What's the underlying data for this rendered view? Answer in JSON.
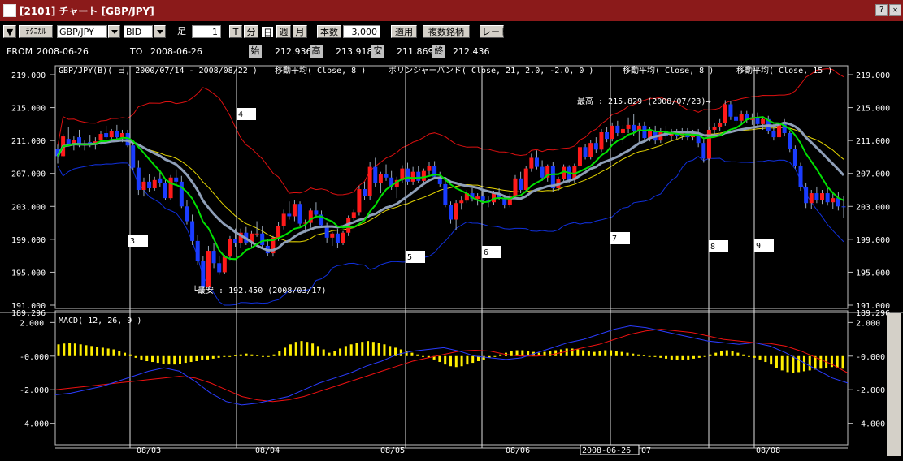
{
  "window": {
    "title": "[2101] チャート [GBP/JPY]"
  },
  "toolbar": {
    "menu_label": "▼",
    "technical_label": "ﾃｸﾆｶﾙ",
    "pair_value": "GBP/JPY",
    "side_value": "BID",
    "foot_label": "足",
    "foot_value": "1",
    "t_label": "T",
    "minute_label": "分",
    "day_label": "日",
    "week_label": "週",
    "month_label": "月",
    "count_label": "本数",
    "count_value": "3,000",
    "apply_label": "適用",
    "compare_label": "複数銘柄",
    "rate_label": "レート"
  },
  "infobar": {
    "from_label": "FROM",
    "from_value": "2008-06-26",
    "to_label": "TO",
    "to_value": "2008-06-26",
    "open_label": "始",
    "open_value": "212.936",
    "high_label": "高",
    "high_value": "213.918",
    "low_label": "安",
    "low_value": "211.869",
    "close_label": "終",
    "close_value": "212.436"
  },
  "chart_data": {
    "type": "candlestick",
    "title": "GBP/JPY(B)( 日, 2000/07/14 - 2008/08/22 )",
    "indicators": [
      "移動平均( Close, 8 )",
      "ボリンジャーバンド( Close, 21, 2.0, -2.0, 0 )",
      "移動平均( Close, 8 )",
      "移動平均( Close, 15 )"
    ],
    "price_axis_ticks": [
      "219.000",
      "215.000",
      "211.000",
      "207.000",
      "203.000",
      "199.000",
      "195.000",
      "191.000"
    ],
    "price_axis_marker": "189.296",
    "ylim": [
      191,
      219
    ],
    "high_annotation": "最高 : 215.829 (2008/07/23)",
    "low_annotation": "最安 : 192.450 (2008/03/17)",
    "wave_labels": [
      "3",
      "4",
      "5",
      "6",
      "7",
      "8",
      "9"
    ],
    "x_ticks": [
      "08/03",
      "08/04",
      "08/05",
      "08/06",
      "07",
      "08/08"
    ],
    "cursor_date": "2008-06-26",
    "macd": {
      "title": "MACD( 12, 26, 9 )",
      "ticks": [
        "2.000",
        "-0.000",
        "-2.000",
        "-4.000"
      ],
      "ylim": [
        -4.5,
        2.5
      ]
    },
    "colors": {
      "up": "#ff1a1a",
      "down": "#1a3cff",
      "ma8": "#00e000",
      "ma15": "#8f9fb8",
      "boll_upper": "#dd1010",
      "boll_lower": "#1030dd",
      "boll_mid": "#e6d600",
      "macd_hist": "#ffee00",
      "macd_line": "#2a3cff",
      "signal_line": "#ee1111"
    },
    "candles": [
      [
        210.0,
        210.5,
        208.2,
        209.1
      ],
      [
        209.1,
        211.8,
        209.0,
        211.5
      ],
      [
        211.2,
        212.6,
        210.4,
        210.6
      ],
      [
        210.6,
        211.5,
        209.8,
        211.1
      ],
      [
        211.4,
        212.3,
        210.2,
        210.4
      ],
      [
        210.4,
        211.0,
        209.8,
        210.5
      ],
      [
        210.8,
        211.7,
        210.2,
        210.6
      ],
      [
        210.6,
        211.4,
        209.9,
        210.9
      ],
      [
        211.0,
        212.2,
        210.5,
        211.8
      ],
      [
        211.9,
        212.8,
        211.2,
        211.4
      ],
      [
        211.4,
        212.4,
        210.9,
        212.1
      ],
      [
        212.2,
        212.9,
        211.1,
        211.4
      ],
      [
        211.4,
        212.3,
        210.8,
        211.9
      ],
      [
        211.9,
        212.3,
        210.2,
        210.4
      ],
      [
        210.4,
        211.0,
        207.4,
        207.7
      ],
      [
        207.7,
        208.6,
        204.4,
        205.0
      ],
      [
        205.0,
        206.5,
        204.2,
        206.0
      ],
      [
        206.0,
        206.9,
        204.8,
        205.2
      ],
      [
        205.2,
        206.6,
        204.9,
        206.2
      ],
      [
        206.4,
        207.3,
        205.4,
        205.8
      ],
      [
        205.8,
        206.4,
        203.8,
        204.0
      ],
      [
        204.0,
        206.8,
        203.8,
        206.5
      ],
      [
        206.5,
        207.5,
        205.6,
        206.0
      ],
      [
        206.0,
        206.7,
        202.8,
        203.0
      ],
      [
        203.0,
        203.8,
        200.8,
        201.2
      ],
      [
        201.2,
        202.0,
        198.3,
        198.8
      ],
      [
        198.8,
        199.5,
        195.9,
        196.4
      ],
      [
        196.4,
        197.0,
        192.5,
        193.2
      ],
      [
        193.2,
        198.2,
        192.9,
        197.6
      ],
      [
        197.6,
        198.5,
        195.5,
        196.1
      ],
      [
        196.1,
        197.0,
        194.7,
        195.0
      ],
      [
        195.0,
        197.1,
        194.8,
        196.9
      ],
      [
        196.9,
        199.4,
        196.5,
        199.0
      ],
      [
        199.0,
        200.3,
        198.1,
        198.5
      ],
      [
        198.5,
        200.3,
        198.0,
        199.8
      ],
      [
        199.8,
        200.5,
        198.3,
        198.6
      ],
      [
        198.6,
        200.0,
        198.0,
        199.7
      ],
      [
        199.7,
        201.2,
        199.3,
        199.7
      ],
      [
        199.7,
        200.6,
        197.9,
        198.3
      ],
      [
        198.2,
        199.0,
        197.0,
        197.3
      ],
      [
        197.3,
        199.4,
        196.9,
        199.2
      ],
      [
        199.2,
        201.1,
        198.8,
        200.6
      ],
      [
        200.6,
        202.6,
        200.2,
        202.1
      ],
      [
        202.1,
        203.6,
        201.4,
        201.8
      ],
      [
        201.8,
        203.8,
        201.2,
        203.3
      ],
      [
        203.3,
        203.6,
        200.6,
        200.9
      ],
      [
        200.9,
        201.4,
        199.8,
        201.0
      ],
      [
        201.0,
        202.8,
        200.4,
        202.5
      ],
      [
        202.5,
        203.5,
        201.6,
        202.0
      ],
      [
        202.0,
        202.5,
        200.5,
        200.7
      ],
      [
        200.7,
        201.0,
        198.6,
        199.2
      ],
      [
        199.2,
        199.9,
        198.2,
        199.7
      ],
      [
        199.7,
        200.3,
        198.0,
        198.5
      ],
      [
        198.5,
        200.0,
        198.3,
        199.8
      ],
      [
        199.8,
        201.9,
        199.4,
        201.6
      ],
      [
        201.6,
        202.6,
        201.3,
        202.3
      ],
      [
        202.3,
        205.5,
        201.9,
        205.1
      ],
      [
        205.1,
        206.0,
        203.8,
        204.3
      ],
      [
        204.3,
        208.4,
        203.8,
        207.8
      ],
      [
        207.8,
        208.9,
        205.4,
        205.8
      ],
      [
        205.8,
        207.2,
        204.6,
        206.9
      ],
      [
        206.9,
        208.1,
        206.1,
        206.5
      ],
      [
        206.5,
        207.3,
        205.0,
        205.3
      ],
      [
        205.3,
        206.6,
        204.0,
        206.2
      ],
      [
        206.2,
        208.0,
        205.8,
        207.6
      ],
      [
        207.6,
        208.3,
        205.6,
        206.0
      ],
      [
        206.0,
        207.8,
        205.6,
        207.2
      ],
      [
        207.2,
        207.9,
        205.8,
        206.1
      ],
      [
        206.1,
        207.6,
        205.8,
        207.3
      ],
      [
        207.3,
        208.4,
        206.8,
        207.9
      ],
      [
        207.9,
        208.5,
        206.3,
        206.6
      ],
      [
        206.6,
        207.2,
        205.4,
        205.7
      ],
      [
        205.7,
        206.3,
        202.9,
        203.2
      ],
      [
        203.2,
        203.6,
        200.9,
        201.4
      ],
      [
        201.4,
        203.8,
        200.1,
        203.4
      ],
      [
        203.4,
        204.2,
        202.6,
        203.7
      ],
      [
        203.7,
        205.0,
        203.4,
        204.6
      ],
      [
        204.6,
        205.2,
        203.6,
        203.9
      ],
      [
        203.9,
        204.6,
        203.1,
        204.2
      ],
      [
        204.2,
        205.0,
        203.3,
        203.7
      ],
      [
        203.7,
        204.3,
        202.9,
        203.5
      ],
      [
        203.5,
        204.9,
        203.2,
        204.6
      ],
      [
        204.6,
        205.2,
        203.8,
        204.0
      ],
      [
        204.0,
        204.4,
        202.8,
        203.2
      ],
      [
        203.2,
        204.6,
        202.9,
        204.3
      ],
      [
        204.3,
        206.8,
        204.0,
        206.4
      ],
      [
        206.4,
        207.2,
        204.6,
        205.0
      ],
      [
        205.0,
        207.9,
        204.7,
        207.6
      ],
      [
        207.6,
        209.4,
        207.2,
        208.9
      ],
      [
        208.9,
        209.8,
        207.5,
        207.8
      ],
      [
        207.8,
        208.6,
        206.1,
        206.5
      ],
      [
        206.5,
        208.1,
        206.0,
        207.9
      ],
      [
        207.9,
        208.4,
        204.8,
        205.2
      ],
      [
        205.2,
        206.6,
        204.9,
        206.3
      ],
      [
        206.3,
        208.1,
        205.9,
        207.8
      ],
      [
        207.8,
        208.0,
        205.8,
        206.2
      ],
      [
        206.2,
        208.2,
        205.9,
        207.9
      ],
      [
        207.9,
        210.6,
        207.6,
        210.2
      ],
      [
        210.2,
        210.6,
        208.7,
        209.0
      ],
      [
        209.0,
        211.1,
        208.7,
        210.7
      ],
      [
        210.7,
        211.4,
        209.5,
        209.9
      ],
      [
        209.9,
        212.4,
        209.6,
        212.0
      ],
      [
        212.0,
        212.6,
        210.8,
        211.2
      ],
      [
        211.2,
        213.2,
        210.9,
        212.8
      ],
      [
        212.8,
        213.4,
        211.5,
        211.9
      ],
      [
        211.9,
        212.9,
        210.6,
        212.4
      ],
      [
        212.4,
        213.8,
        211.9,
        212.9
      ],
      [
        212.9,
        214.2,
        211.6,
        212.2
      ],
      [
        212.2,
        213.2,
        210.8,
        212.8
      ],
      [
        212.8,
        213.3,
        211.0,
        211.3
      ],
      [
        211.3,
        212.6,
        210.9,
        212.2
      ],
      [
        212.2,
        212.8,
        210.6,
        211.0
      ],
      [
        211.0,
        212.5,
        210.7,
        212.1
      ],
      [
        212.1,
        212.8,
        211.2,
        211.6
      ],
      [
        211.6,
        212.4,
        210.9,
        212.0
      ],
      [
        212.0,
        212.4,
        211.2,
        211.6
      ],
      [
        211.6,
        212.5,
        211.1,
        212.1
      ],
      [
        212.1,
        212.5,
        211.0,
        211.4
      ],
      [
        211.4,
        212.3,
        211.0,
        211.9
      ],
      [
        211.9,
        212.4,
        210.2,
        210.7
      ],
      [
        210.7,
        211.2,
        208.3,
        208.8
      ],
      [
        208.8,
        212.7,
        208.6,
        212.3
      ],
      [
        212.3,
        213.1,
        211.7,
        212.6
      ],
      [
        212.6,
        213.6,
        212.2,
        213.1
      ],
      [
        213.1,
        215.9,
        212.8,
        215.4
      ],
      [
        215.4,
        215.8,
        213.5,
        213.9
      ],
      [
        213.9,
        214.4,
        212.8,
        213.4
      ],
      [
        213.4,
        214.6,
        212.9,
        214.2
      ],
      [
        214.2,
        214.6,
        213.1,
        213.5
      ],
      [
        213.5,
        214.3,
        212.9,
        213.8
      ],
      [
        213.8,
        214.4,
        212.6,
        213.0
      ],
      [
        213.0,
        213.9,
        212.3,
        213.6
      ],
      [
        213.6,
        214.0,
        211.8,
        212.2
      ],
      [
        212.2,
        213.0,
        211.0,
        211.4
      ],
      [
        211.4,
        213.4,
        211.1,
        213.1
      ],
      [
        213.1,
        213.6,
        211.5,
        211.9
      ],
      [
        211.9,
        212.2,
        209.6,
        210.0
      ],
      [
        210.0,
        210.4,
        207.6,
        207.9
      ],
      [
        207.9,
        208.3,
        204.9,
        205.3
      ],
      [
        205.3,
        205.8,
        202.8,
        203.4
      ],
      [
        203.4,
        205.0,
        202.7,
        204.6
      ],
      [
        204.6,
        205.4,
        203.4,
        203.8
      ],
      [
        203.8,
        205.0,
        203.3,
        204.6
      ],
      [
        204.6,
        205.2,
        203.1,
        203.5
      ],
      [
        203.5,
        204.6,
        202.7,
        204.0
      ],
      [
        204.0,
        204.8,
        202.5,
        203.0
      ],
      [
        203.0,
        204.3,
        201.6,
        202.9
      ]
    ],
    "macd_hist": [
      0.7,
      0.75,
      0.8,
      0.75,
      0.7,
      0.65,
      0.6,
      0.55,
      0.5,
      0.45,
      0.4,
      0.3,
      0.2,
      0.1,
      -0.1,
      -0.2,
      -0.3,
      -0.35,
      -0.4,
      -0.45,
      -0.5,
      -0.5,
      -0.45,
      -0.4,
      -0.35,
      -0.3,
      -0.25,
      -0.2,
      -0.15,
      -0.1,
      -0.05,
      -0.05,
      0.05,
      0.1,
      0.15,
      0.1,
      0.05,
      0.0,
      -0.05,
      0.1,
      0.3,
      0.5,
      0.7,
      0.85,
      0.9,
      0.85,
      0.75,
      0.6,
      0.4,
      0.2,
      0.3,
      0.45,
      0.6,
      0.7,
      0.8,
      0.85,
      0.9,
      0.85,
      0.8,
      0.7,
      0.6,
      0.5,
      0.4,
      0.3,
      0.2,
      0.1,
      0.0,
      -0.1,
      -0.2,
      -0.35,
      -0.5,
      -0.6,
      -0.65,
      -0.6,
      -0.5,
      -0.4,
      -0.3,
      -0.2,
      -0.1,
      0.0,
      0.1,
      0.2,
      0.3,
      0.35,
      0.35,
      0.3,
      0.25,
      0.2,
      0.25,
      0.3,
      0.35,
      0.4,
      0.45,
      0.45,
      0.4,
      0.35,
      0.3,
      0.25,
      0.3,
      0.35,
      0.35,
      0.3,
      0.25,
      0.2,
      0.15,
      0.1,
      0.05,
      0.0,
      -0.05,
      -0.1,
      -0.15,
      -0.2,
      -0.25,
      -0.25,
      -0.2,
      -0.15,
      -0.1,
      0.0,
      0.1,
      0.2,
      0.3,
      0.35,
      0.3,
      0.2,
      0.1,
      0.0,
      -0.1,
      -0.2,
      -0.35,
      -0.5,
      -0.7,
      -0.85,
      -0.95,
      -1.0,
      -0.95,
      -0.9,
      -0.85,
      -0.8,
      -0.75,
      -0.7,
      -0.65,
      -0.7,
      -0.75
    ],
    "macd_line": [
      -2.3,
      -2.2,
      -2.0,
      -1.8,
      -1.5,
      -1.2,
      -0.9,
      -0.7,
      -0.9,
      -1.5,
      -2.2,
      -2.7,
      -2.9,
      -2.8,
      -2.6,
      -2.4,
      -2.0,
      -1.6,
      -1.3,
      -1.0,
      -0.6,
      -0.3,
      0.1,
      0.3,
      0.4,
      0.5,
      0.3,
      0.0,
      -0.1,
      -0.2,
      -0.1,
      0.2,
      0.5,
      0.8,
      1.0,
      1.3,
      1.6,
      1.8,
      1.7,
      1.5,
      1.3,
      1.1,
      0.9,
      0.8,
      0.7,
      0.8,
      0.6,
      0.2,
      -0.3,
      -0.8,
      -1.3,
      -1.6
    ],
    "signal_line": [
      -2.0,
      -1.9,
      -1.8,
      -1.7,
      -1.6,
      -1.5,
      -1.4,
      -1.3,
      -1.2,
      -1.3,
      -1.6,
      -2.0,
      -2.4,
      -2.6,
      -2.7,
      -2.6,
      -2.4,
      -2.1,
      -1.8,
      -1.5,
      -1.2,
      -0.9,
      -0.6,
      -0.3,
      -0.1,
      0.1,
      0.3,
      0.35,
      0.3,
      0.1,
      0.0,
      0.0,
      0.1,
      0.3,
      0.5,
      0.7,
      1.0,
      1.3,
      1.5,
      1.6,
      1.5,
      1.4,
      1.2,
      1.0,
      0.9,
      0.8,
      0.75,
      0.6,
      0.3,
      -0.1,
      -0.5,
      -1.0
    ]
  }
}
